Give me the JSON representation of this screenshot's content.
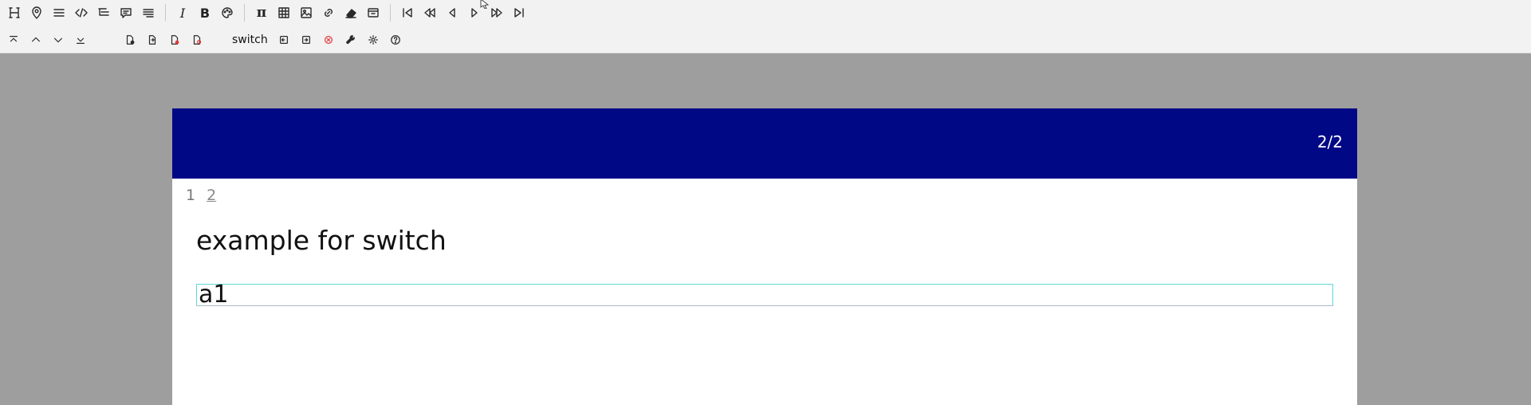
{
  "toolbar": {
    "row1": [
      {
        "icon": "heading-icon"
      },
      {
        "icon": "map-pin-icon"
      },
      {
        "icon": "list-icon"
      },
      {
        "icon": "code-icon"
      },
      {
        "icon": "tree-list-icon"
      },
      {
        "icon": "comment-icon"
      },
      {
        "icon": "paragraph-icon"
      },
      {
        "sep": true
      },
      {
        "icon": "italic-icon",
        "glyph": "I"
      },
      {
        "icon": "bold-icon",
        "glyph": "B"
      },
      {
        "icon": "palette-icon"
      },
      {
        "sep": true
      },
      {
        "icon": "pi-icon",
        "glyph": "π"
      },
      {
        "icon": "table-icon"
      },
      {
        "icon": "image-icon"
      },
      {
        "icon": "link-icon"
      },
      {
        "icon": "eraser-icon"
      },
      {
        "icon": "window-icon"
      },
      {
        "sep": true
      },
      {
        "icon": "first-slide-icon"
      },
      {
        "icon": "rewind-icon"
      },
      {
        "icon": "previous-icon"
      },
      {
        "icon": "play-icon"
      },
      {
        "icon": "fast-forward-icon"
      },
      {
        "icon": "last-slide-icon"
      }
    ],
    "row2_label": "switch"
  },
  "slide": {
    "page_counter": "2/2",
    "nav": [
      "1",
      "2"
    ],
    "title": "example for switch",
    "input_value": "a1"
  },
  "colors": {
    "header": "#000885",
    "background": "#9e9e9e",
    "input_border": "#5fd8d8",
    "stop_icon": "#e23b3b"
  }
}
